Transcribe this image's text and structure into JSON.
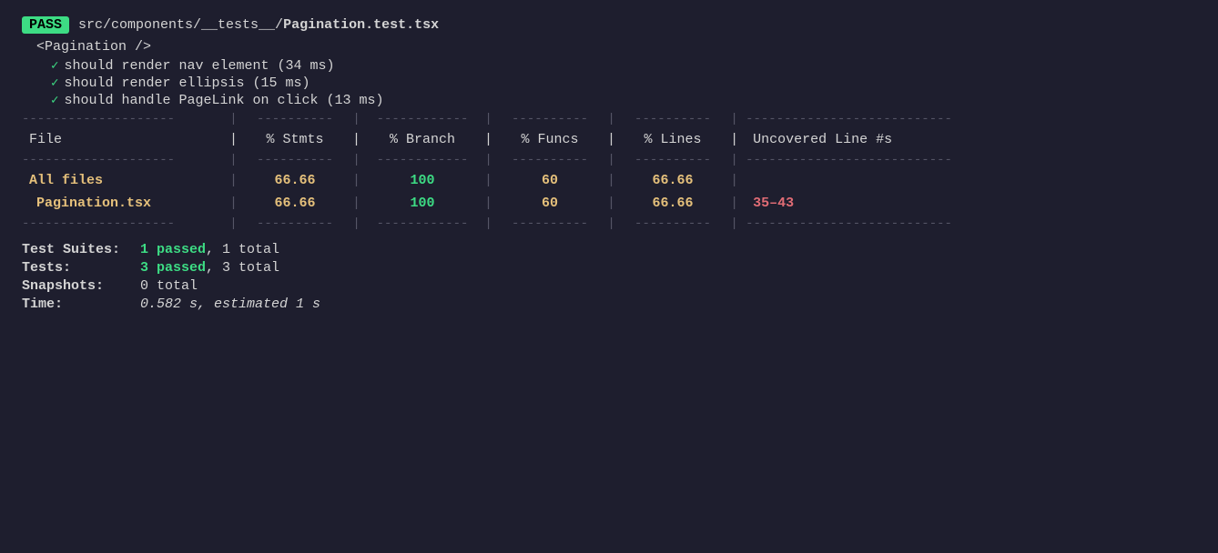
{
  "header": {
    "pass_label": "PASS",
    "file_path_prefix": "src/components/__tests__/",
    "file_path_bold": "Pagination.test.tsx"
  },
  "suite": {
    "name": "<Pagination />",
    "tests": [
      {
        "label": "should render nav element (34 ms)"
      },
      {
        "label": "should render ellipsis (15 ms)"
      },
      {
        "label": "should handle PageLink on click (13 ms)"
      }
    ]
  },
  "coverage": {
    "columns": {
      "file": "File",
      "stmts": "% Stmts",
      "branch": "% Branch",
      "funcs": "% Funcs",
      "lines": "% Lines",
      "uncovered": "Uncovered Line #s"
    },
    "rows": [
      {
        "file": "All files",
        "stmts": "66.66",
        "branch": "100",
        "funcs": "60",
        "lines": "66.66",
        "uncovered": ""
      },
      {
        "file": "Pagination.tsx",
        "stmts": "66.66",
        "branch": "100",
        "funcs": "60",
        "lines": "66.66",
        "uncovered": "35–43"
      }
    ]
  },
  "summary": {
    "suites_label": "Test Suites:",
    "suites_value_green": "1 passed",
    "suites_value_rest": ", 1 total",
    "tests_label": "Tests:",
    "tests_value_green": "3 passed",
    "tests_value_rest": ", 3 total",
    "snapshots_label": "Snapshots:",
    "snapshots_value": "0 total",
    "time_label": "Time:",
    "time_value": "0.582 s, estimated 1 s"
  }
}
